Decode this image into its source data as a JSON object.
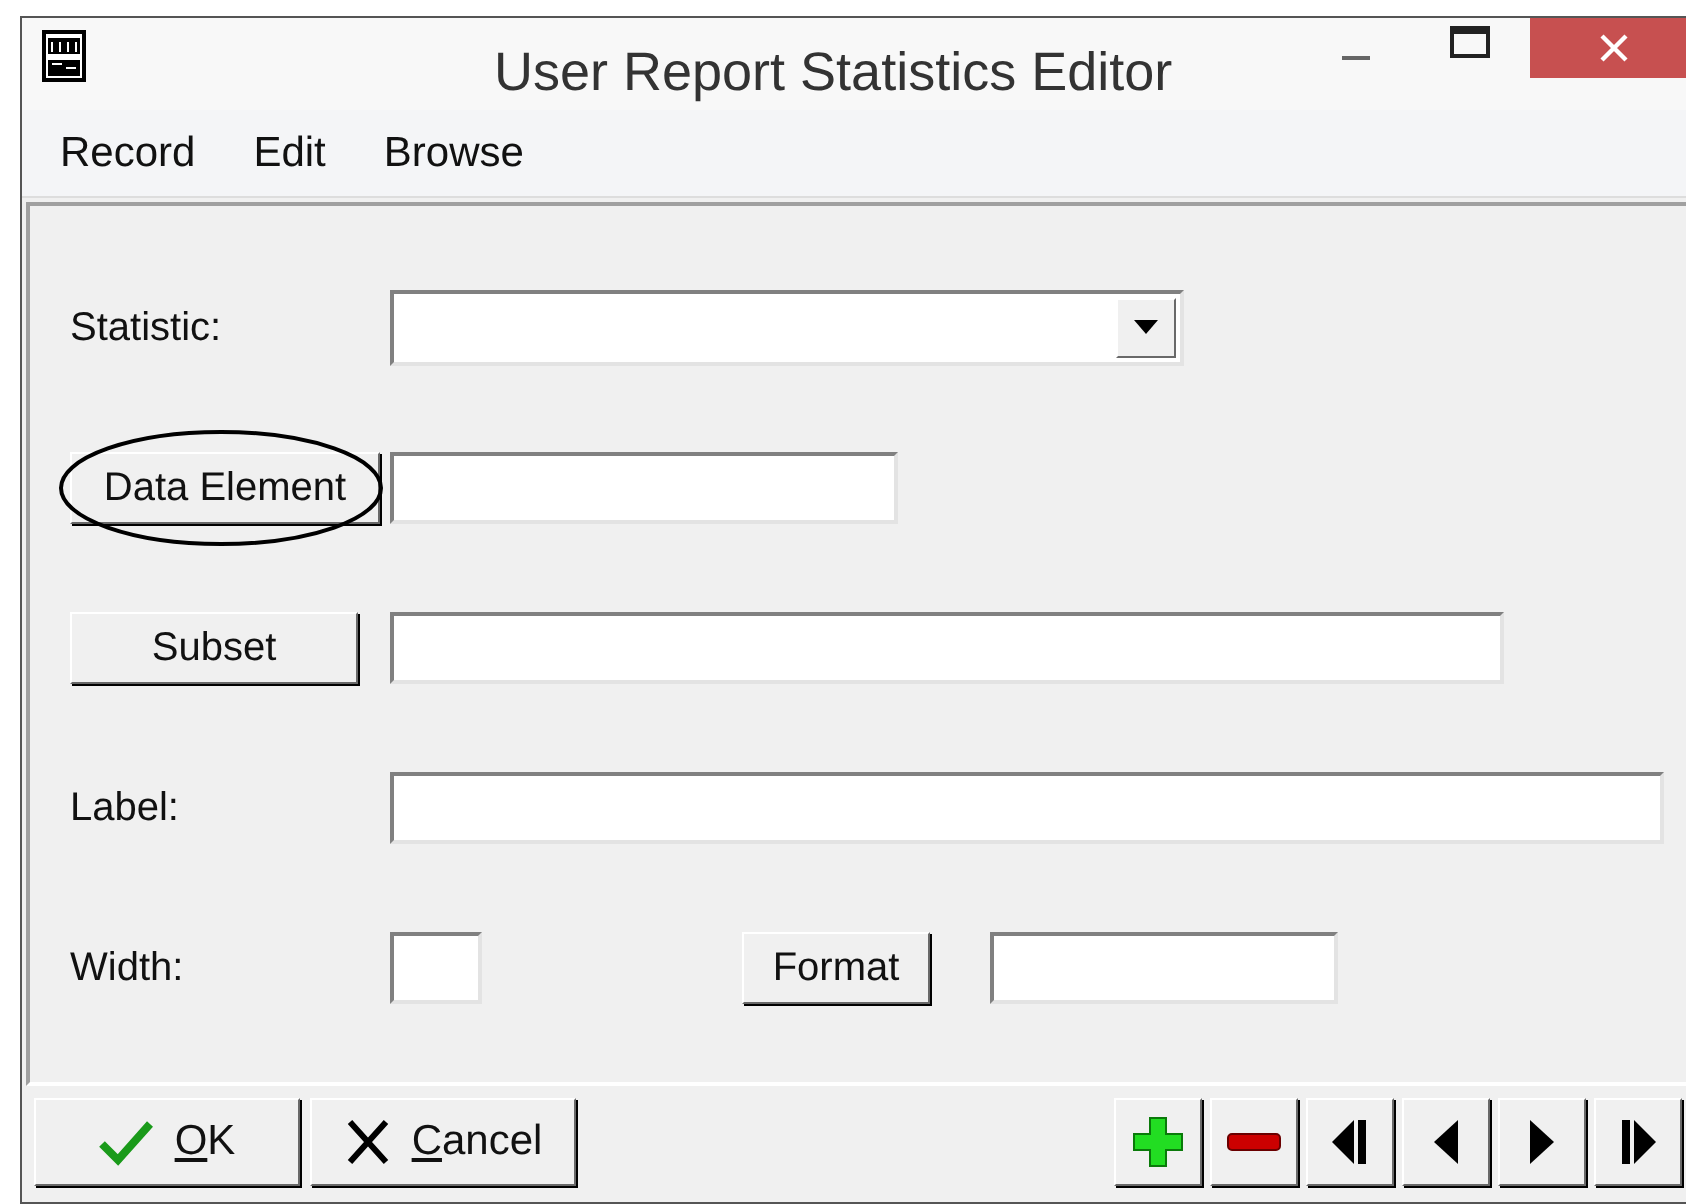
{
  "window": {
    "title": "User Report Statistics Editor"
  },
  "menu": [
    "Record",
    "Edit",
    "Browse"
  ],
  "rows": [
    {
      "items": [
        {
          "kind": "label",
          "text": "Statistic:"
        },
        {
          "kind": "dropdown"
        }
      ]
    },
    {
      "items": [
        {
          "kind": "button",
          "text": "Data Element",
          "highlighted": true
        },
        {
          "kind": "field"
        }
      ]
    },
    {
      "items": [
        {
          "kind": "button",
          "text": "Subset",
          "highlighted": false
        },
        {
          "kind": "field"
        }
      ]
    },
    {
      "items": [
        {
          "kind": "label",
          "text": "Label:"
        },
        {
          "kind": "field"
        }
      ]
    },
    {
      "items": [
        {
          "kind": "label",
          "text": "Width:"
        },
        {
          "kind": "field"
        },
        {
          "kind": "button",
          "text": "Format",
          "highlighted": false
        },
        {
          "kind": "field"
        }
      ]
    }
  ],
  "actions": [
    {
      "kind": "ok",
      "label": "OK"
    },
    {
      "kind": "cancel",
      "label": "Cancel"
    }
  ],
  "navigation": [
    {
      "kind": "add"
    },
    {
      "kind": "remove"
    },
    {
      "kind": "first"
    },
    {
      "kind": "prev"
    },
    {
      "kind": "next"
    },
    {
      "kind": "last"
    }
  ]
}
